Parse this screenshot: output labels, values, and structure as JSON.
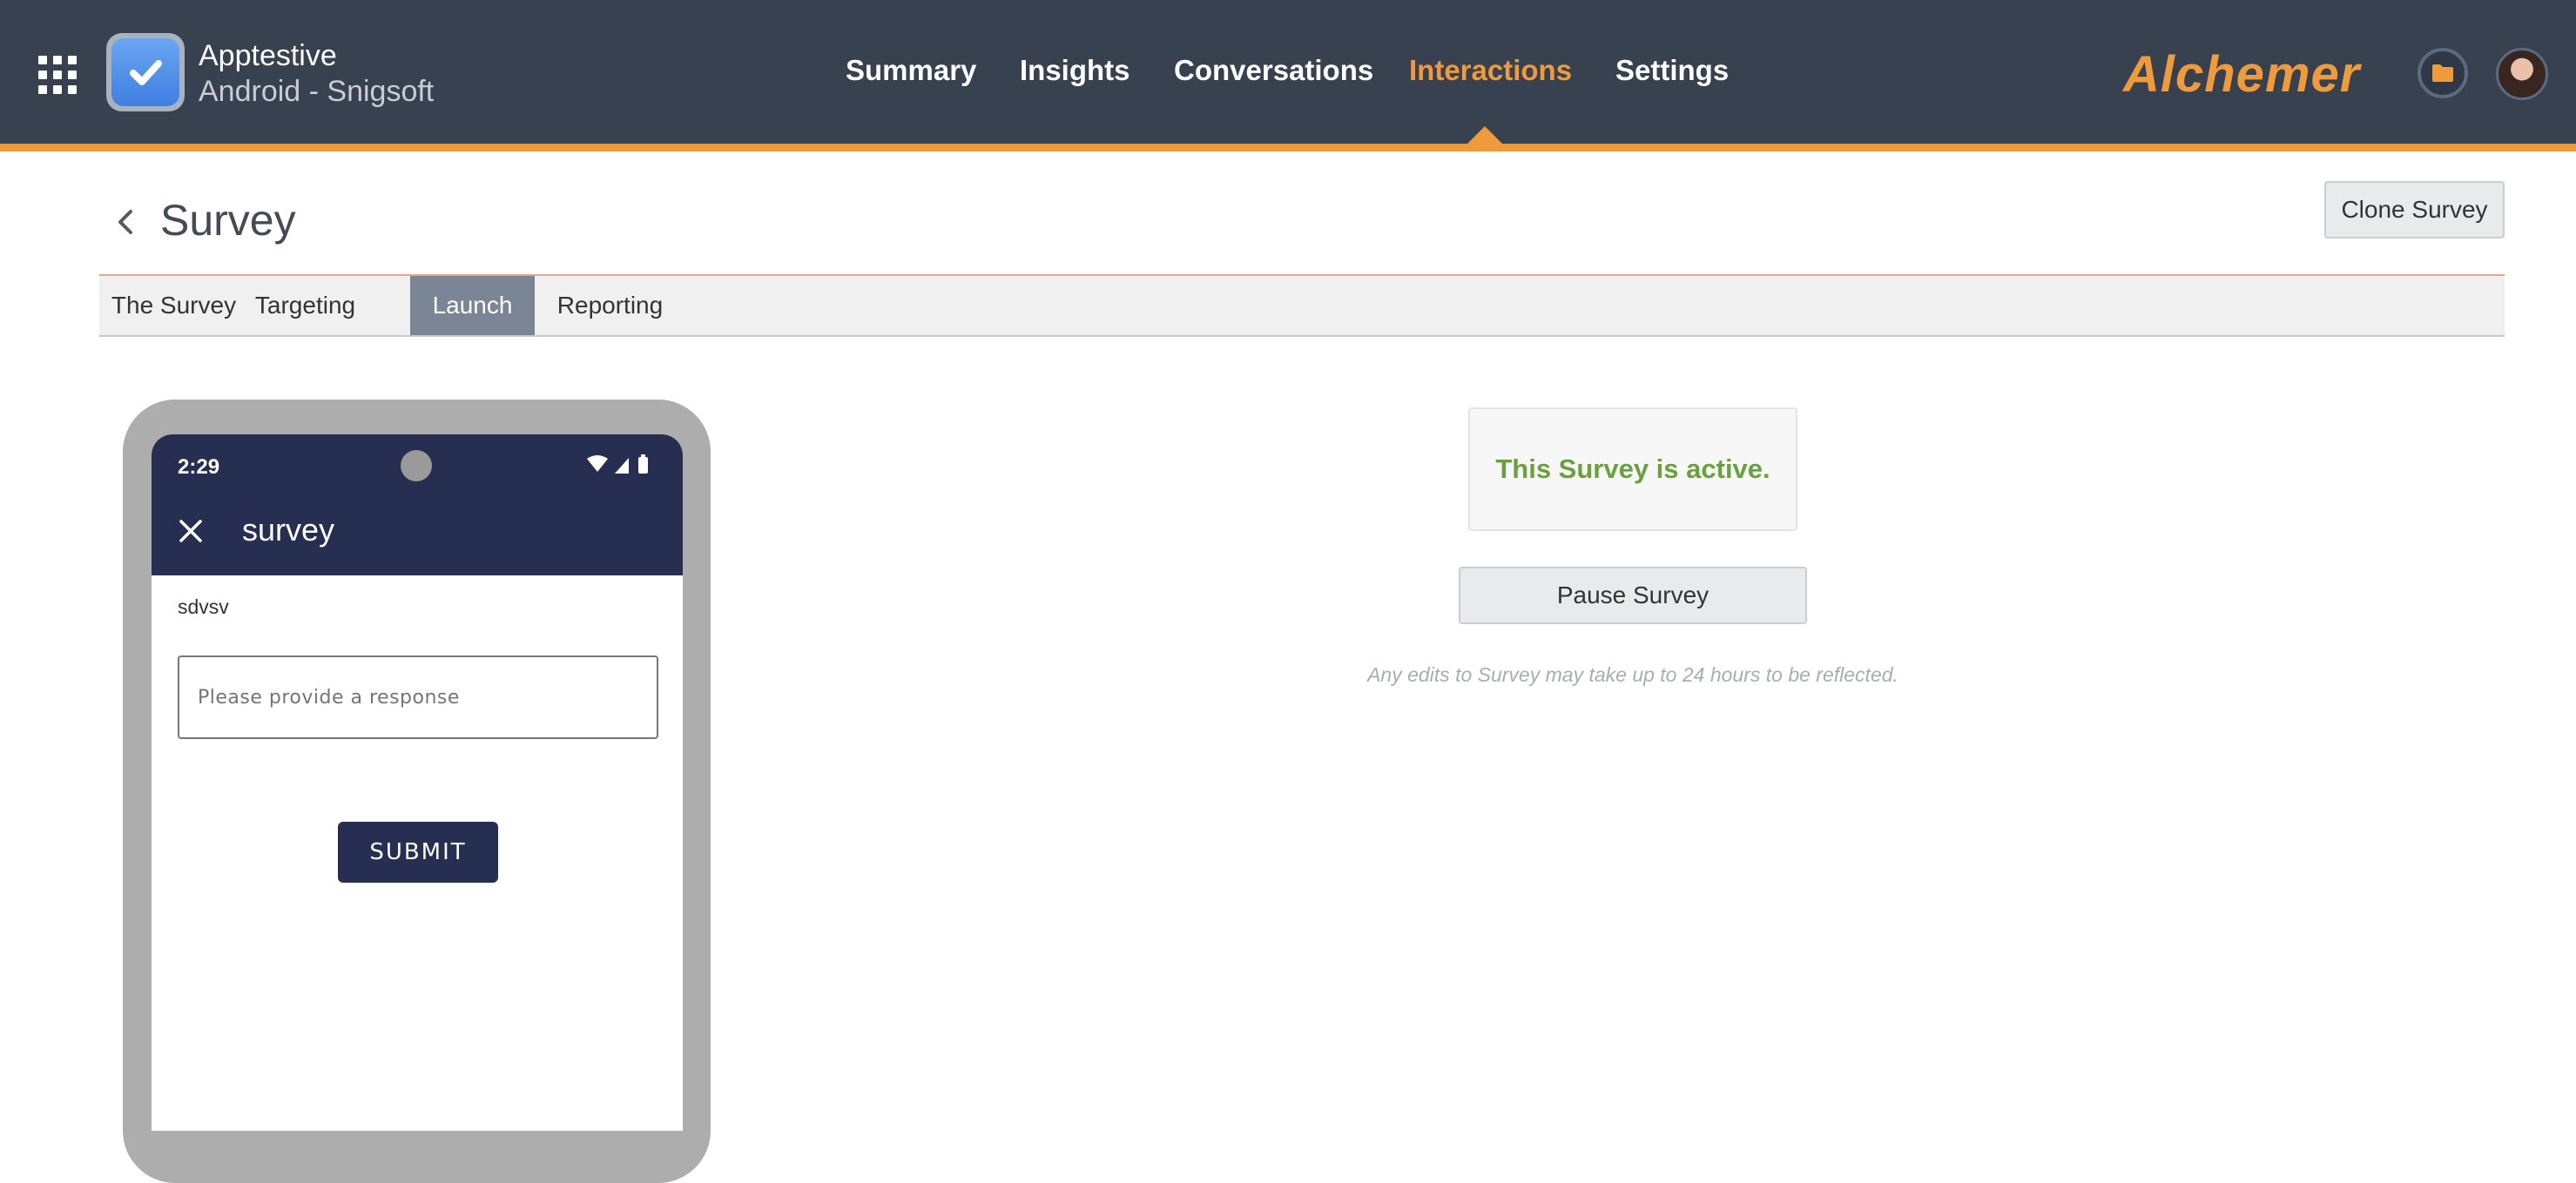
{
  "header": {
    "app_name": "Apptestive",
    "app_subtitle": "Android - Snigsoft",
    "nav": [
      "Summary",
      "Insights",
      "Conversations",
      "Interactions",
      "Settings"
    ],
    "active_nav": "Interactions",
    "brand": "Alchemer",
    "accent_color": "#ef9a3b",
    "bar_color": "#374150",
    "icons": [
      "apps-grid-icon",
      "app-checkmark-icon",
      "folder-icon",
      "user-avatar"
    ]
  },
  "page": {
    "title": "Survey",
    "back_icon": "chevron-left-icon",
    "clone_button": "Clone Survey",
    "tabs": [
      "The Survey",
      "Targeting",
      "Launch",
      "Reporting"
    ],
    "active_tab": "Launch"
  },
  "preview": {
    "time": "2:29",
    "app_bar_title": "survey",
    "question": "sdvsv",
    "response_placeholder": "Please provide a response",
    "submit_label": "SUBMIT",
    "phone_color": "#262f51"
  },
  "status": {
    "message": "This Survey is active.",
    "message_color": "#6aa03d",
    "pause_button": "Pause Survey",
    "note": "Any edits to Survey may take up to 24 hours to be reflected."
  }
}
